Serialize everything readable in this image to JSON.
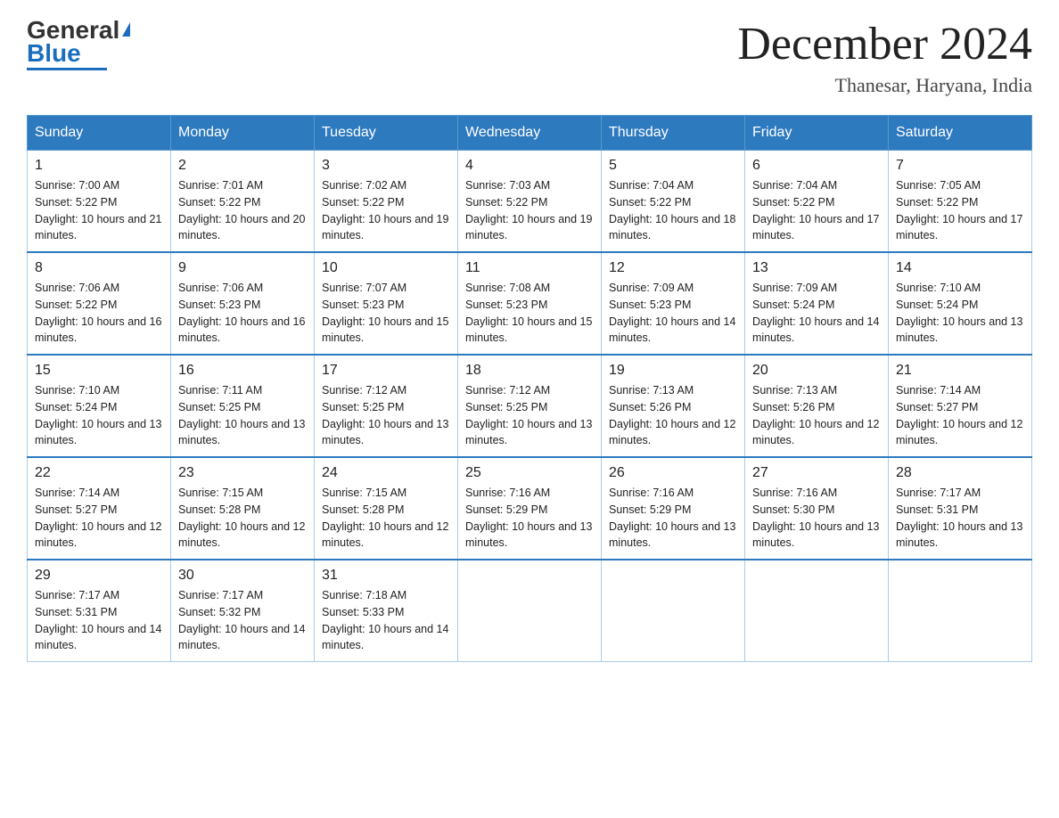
{
  "logo": {
    "general": "General",
    "blue": "Blue",
    "triangle_char": "▶"
  },
  "header": {
    "title": "December 2024",
    "subtitle": "Thanesar, Haryana, India"
  },
  "days_of_week": [
    "Sunday",
    "Monday",
    "Tuesday",
    "Wednesday",
    "Thursday",
    "Friday",
    "Saturday"
  ],
  "weeks": [
    [
      {
        "day": "1",
        "sunrise": "7:00 AM",
        "sunset": "5:22 PM",
        "daylight": "10 hours and 21 minutes."
      },
      {
        "day": "2",
        "sunrise": "7:01 AM",
        "sunset": "5:22 PM",
        "daylight": "10 hours and 20 minutes."
      },
      {
        "day": "3",
        "sunrise": "7:02 AM",
        "sunset": "5:22 PM",
        "daylight": "10 hours and 19 minutes."
      },
      {
        "day": "4",
        "sunrise": "7:03 AM",
        "sunset": "5:22 PM",
        "daylight": "10 hours and 19 minutes."
      },
      {
        "day": "5",
        "sunrise": "7:04 AM",
        "sunset": "5:22 PM",
        "daylight": "10 hours and 18 minutes."
      },
      {
        "day": "6",
        "sunrise": "7:04 AM",
        "sunset": "5:22 PM",
        "daylight": "10 hours and 17 minutes."
      },
      {
        "day": "7",
        "sunrise": "7:05 AM",
        "sunset": "5:22 PM",
        "daylight": "10 hours and 17 minutes."
      }
    ],
    [
      {
        "day": "8",
        "sunrise": "7:06 AM",
        "sunset": "5:22 PM",
        "daylight": "10 hours and 16 minutes."
      },
      {
        "day": "9",
        "sunrise": "7:06 AM",
        "sunset": "5:23 PM",
        "daylight": "10 hours and 16 minutes."
      },
      {
        "day": "10",
        "sunrise": "7:07 AM",
        "sunset": "5:23 PM",
        "daylight": "10 hours and 15 minutes."
      },
      {
        "day": "11",
        "sunrise": "7:08 AM",
        "sunset": "5:23 PM",
        "daylight": "10 hours and 15 minutes."
      },
      {
        "day": "12",
        "sunrise": "7:09 AM",
        "sunset": "5:23 PM",
        "daylight": "10 hours and 14 minutes."
      },
      {
        "day": "13",
        "sunrise": "7:09 AM",
        "sunset": "5:24 PM",
        "daylight": "10 hours and 14 minutes."
      },
      {
        "day": "14",
        "sunrise": "7:10 AM",
        "sunset": "5:24 PM",
        "daylight": "10 hours and 13 minutes."
      }
    ],
    [
      {
        "day": "15",
        "sunrise": "7:10 AM",
        "sunset": "5:24 PM",
        "daylight": "10 hours and 13 minutes."
      },
      {
        "day": "16",
        "sunrise": "7:11 AM",
        "sunset": "5:25 PM",
        "daylight": "10 hours and 13 minutes."
      },
      {
        "day": "17",
        "sunrise": "7:12 AM",
        "sunset": "5:25 PM",
        "daylight": "10 hours and 13 minutes."
      },
      {
        "day": "18",
        "sunrise": "7:12 AM",
        "sunset": "5:25 PM",
        "daylight": "10 hours and 13 minutes."
      },
      {
        "day": "19",
        "sunrise": "7:13 AM",
        "sunset": "5:26 PM",
        "daylight": "10 hours and 12 minutes."
      },
      {
        "day": "20",
        "sunrise": "7:13 AM",
        "sunset": "5:26 PM",
        "daylight": "10 hours and 12 minutes."
      },
      {
        "day": "21",
        "sunrise": "7:14 AM",
        "sunset": "5:27 PM",
        "daylight": "10 hours and 12 minutes."
      }
    ],
    [
      {
        "day": "22",
        "sunrise": "7:14 AM",
        "sunset": "5:27 PM",
        "daylight": "10 hours and 12 minutes."
      },
      {
        "day": "23",
        "sunrise": "7:15 AM",
        "sunset": "5:28 PM",
        "daylight": "10 hours and 12 minutes."
      },
      {
        "day": "24",
        "sunrise": "7:15 AM",
        "sunset": "5:28 PM",
        "daylight": "10 hours and 12 minutes."
      },
      {
        "day": "25",
        "sunrise": "7:16 AM",
        "sunset": "5:29 PM",
        "daylight": "10 hours and 13 minutes."
      },
      {
        "day": "26",
        "sunrise": "7:16 AM",
        "sunset": "5:29 PM",
        "daylight": "10 hours and 13 minutes."
      },
      {
        "day": "27",
        "sunrise": "7:16 AM",
        "sunset": "5:30 PM",
        "daylight": "10 hours and 13 minutes."
      },
      {
        "day": "28",
        "sunrise": "7:17 AM",
        "sunset": "5:31 PM",
        "daylight": "10 hours and 13 minutes."
      }
    ],
    [
      {
        "day": "29",
        "sunrise": "7:17 AM",
        "sunset": "5:31 PM",
        "daylight": "10 hours and 14 minutes."
      },
      {
        "day": "30",
        "sunrise": "7:17 AM",
        "sunset": "5:32 PM",
        "daylight": "10 hours and 14 minutes."
      },
      {
        "day": "31",
        "sunrise": "7:18 AM",
        "sunset": "5:33 PM",
        "daylight": "10 hours and 14 minutes."
      },
      null,
      null,
      null,
      null
    ]
  ]
}
